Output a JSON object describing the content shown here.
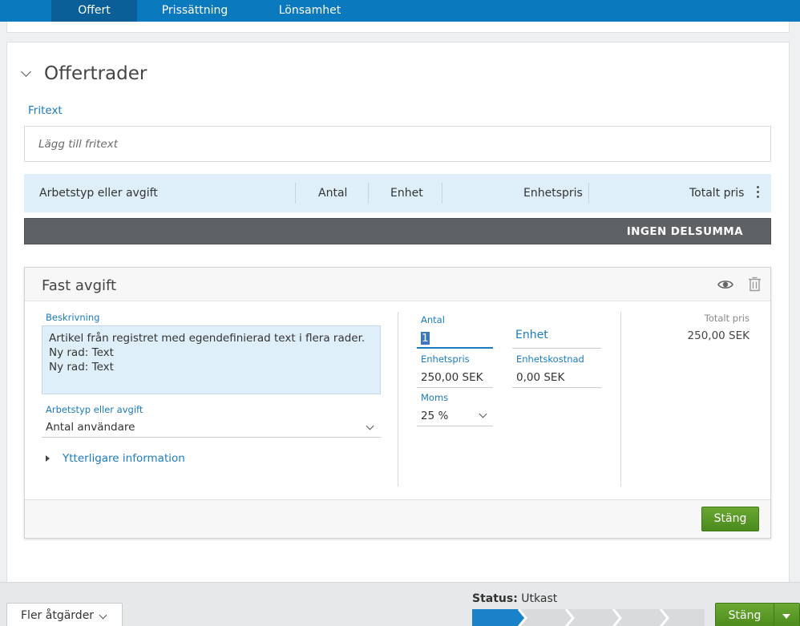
{
  "tabs": [
    {
      "label": "Offert",
      "active": true
    },
    {
      "label": "Prissättning",
      "active": false
    },
    {
      "label": "Lönsamhet",
      "active": false
    }
  ],
  "section": {
    "title": "Offertrader"
  },
  "fritext": {
    "label": "Fritext",
    "placeholder": "Lägg till fritext"
  },
  "table_header": {
    "columns": [
      "Arbetstyp eller avgift",
      "Antal",
      "Enhet",
      "Enhetspris",
      "Totalt pris"
    ]
  },
  "subtotal_label": "INGEN DELSUMMA",
  "item": {
    "title": "Fast avgift",
    "description_label": "Beskrivning",
    "description_lines": [
      "Artikel från registret med egendefinierad text i flera rader.",
      "Ny rad: Text",
      "Ny rad: Text"
    ],
    "worktype_label": "Arbetstyp eller avgift",
    "worktype_value": "Antal användare",
    "more_info": "Ytterligare information",
    "antal_label": "Antal",
    "antal_value": "1",
    "enhet_label": "Enhet",
    "enhetspris_label": "Enhetspris",
    "enhetspris_value": "250,00 SEK",
    "enhetskostnad_label": "Enhetskostnad",
    "enhetskostnad_value": "0,00 SEK",
    "moms_label": "Moms",
    "moms_value": "25 %",
    "total_label": "Totalt pris",
    "total_value": "250,00 SEK",
    "close_button": "Stäng"
  },
  "footer": {
    "more_actions": "Fler åtgärder",
    "status_label": "Status:",
    "status_value": "Utkast",
    "close_button": "Stäng"
  },
  "colors": {
    "primary": "#0b79bd",
    "tab_active": "#0a5f99",
    "link": "#1a7cbf",
    "green": "#5a9a26",
    "header_bg": "#dfeffa",
    "subtotal_bg": "#5f6264"
  },
  "icons": [
    "chevron-down-icon",
    "kebab-menu-icon",
    "eye-icon",
    "trash-icon",
    "caret-right-icon"
  ]
}
